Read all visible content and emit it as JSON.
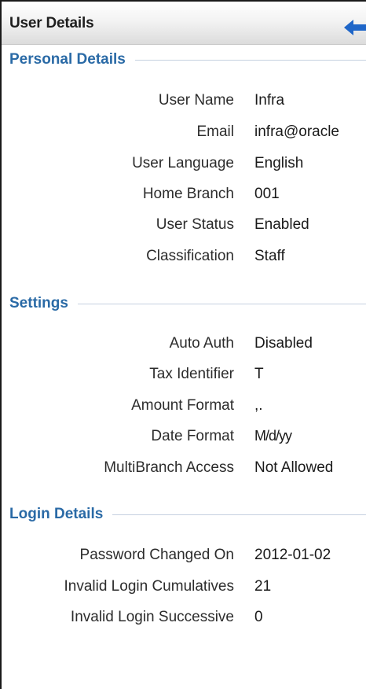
{
  "header": {
    "title": "User Details",
    "back_icon": "back-arrow-icon",
    "accent": "#1f66c8"
  },
  "sections": {
    "personal": {
      "title": "Personal Details",
      "rows": [
        {
          "label": "User Name",
          "value": "Infra"
        },
        {
          "label": "Email",
          "value": "infra@oracle"
        },
        {
          "label": "User Language",
          "value": "English"
        },
        {
          "label": "Home Branch",
          "value": "001"
        },
        {
          "label": "User Status",
          "value": "Enabled"
        },
        {
          "label": "Classification",
          "value": "Staff"
        }
      ]
    },
    "settings": {
      "title": "Settings",
      "rows": [
        {
          "label": "Auto Auth",
          "value": "Disabled"
        },
        {
          "label": "Tax Identifier",
          "value": "T"
        },
        {
          "label": "Amount Format",
          "value": ",."
        },
        {
          "label": "Date Format",
          "value": "M/d/yy"
        },
        {
          "label": "MultiBranch Access",
          "value": "Not Allowed"
        }
      ]
    },
    "login": {
      "title": "Login Details",
      "rows": [
        {
          "label": "Password Changed On",
          "value": "2012-01-02"
        },
        {
          "label": "Invalid Login Cumulatives",
          "value": "21"
        },
        {
          "label": "Invalid Login Successive",
          "value": "0"
        }
      ]
    }
  },
  "colors": {
    "section_title": "#2a6aa6",
    "rule": "#c5d0e0"
  }
}
